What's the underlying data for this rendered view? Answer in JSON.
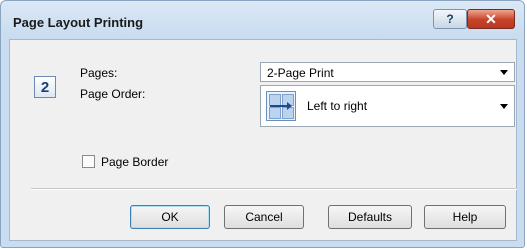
{
  "window": {
    "title": "Page Layout Printing",
    "help_glyph": "?",
    "close_glyph": "✕"
  },
  "page_icon": {
    "label": "2"
  },
  "pages": {
    "label": "Pages:",
    "value": "2-Page Print"
  },
  "page_order": {
    "label": "Page Order:",
    "value": "Left to right",
    "icon": "left-to-right-order-icon"
  },
  "page_border": {
    "label": "Page Border",
    "checked": false
  },
  "buttons": {
    "ok": "OK",
    "cancel": "Cancel",
    "defaults": "Defaults",
    "help": "Help"
  }
}
